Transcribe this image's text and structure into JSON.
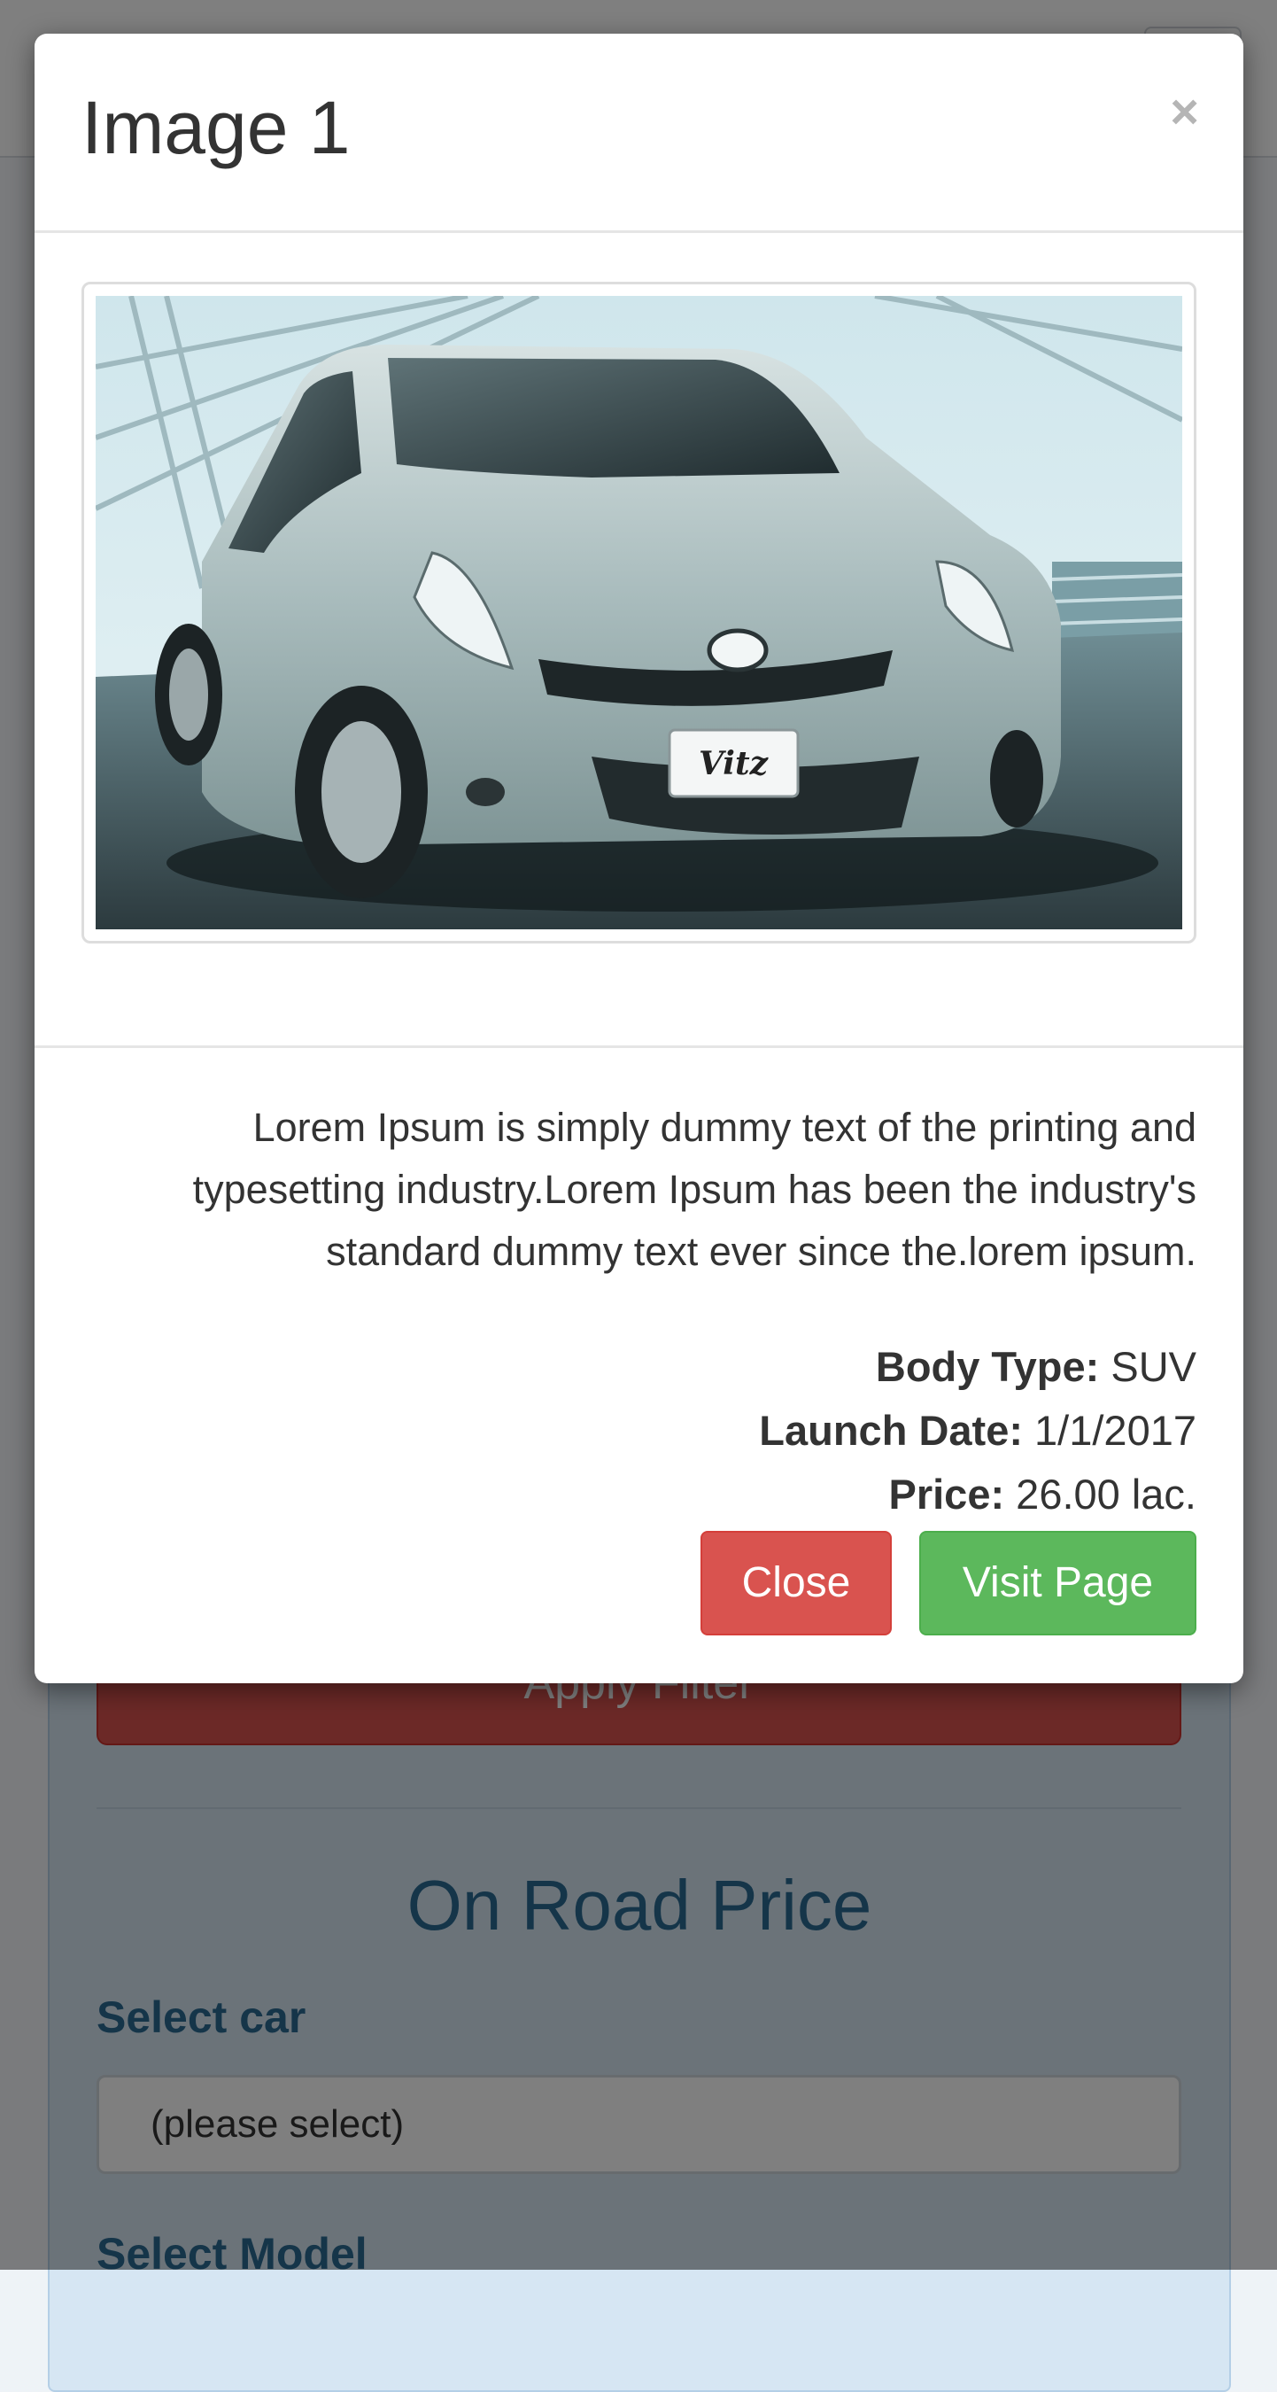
{
  "background": {
    "apply_filter_label": "Apply Filter",
    "section_title": "On Road Price",
    "select_car_label": "Select car",
    "select_car_value": "(please select)",
    "select_model_label": "Select Model"
  },
  "modal": {
    "title": "Image 1",
    "close_glyph": "×",
    "image": {
      "subject": "silver Toyota Vitz hatchback",
      "plate_text": "Vitz"
    },
    "description": "Lorem Ipsum is simply dummy text of the printing and typesetting industry.Lorem Ipsum has been the industry's standard dummy text ever since the.lorem ipsum.",
    "specs": {
      "body_type_label": "Body Type:",
      "body_type_value": " SUV",
      "launch_date_label": "Launch Date:",
      "launch_date_value": " 1/1/2017",
      "price_label": "Price:",
      "price_value": " 26.00 lac."
    },
    "buttons": {
      "close_label": "Close",
      "visit_label": "Visit Page"
    }
  },
  "colors": {
    "danger": "#d9534f",
    "success": "#5cb85c",
    "heading_blue": "#2a6b93"
  }
}
